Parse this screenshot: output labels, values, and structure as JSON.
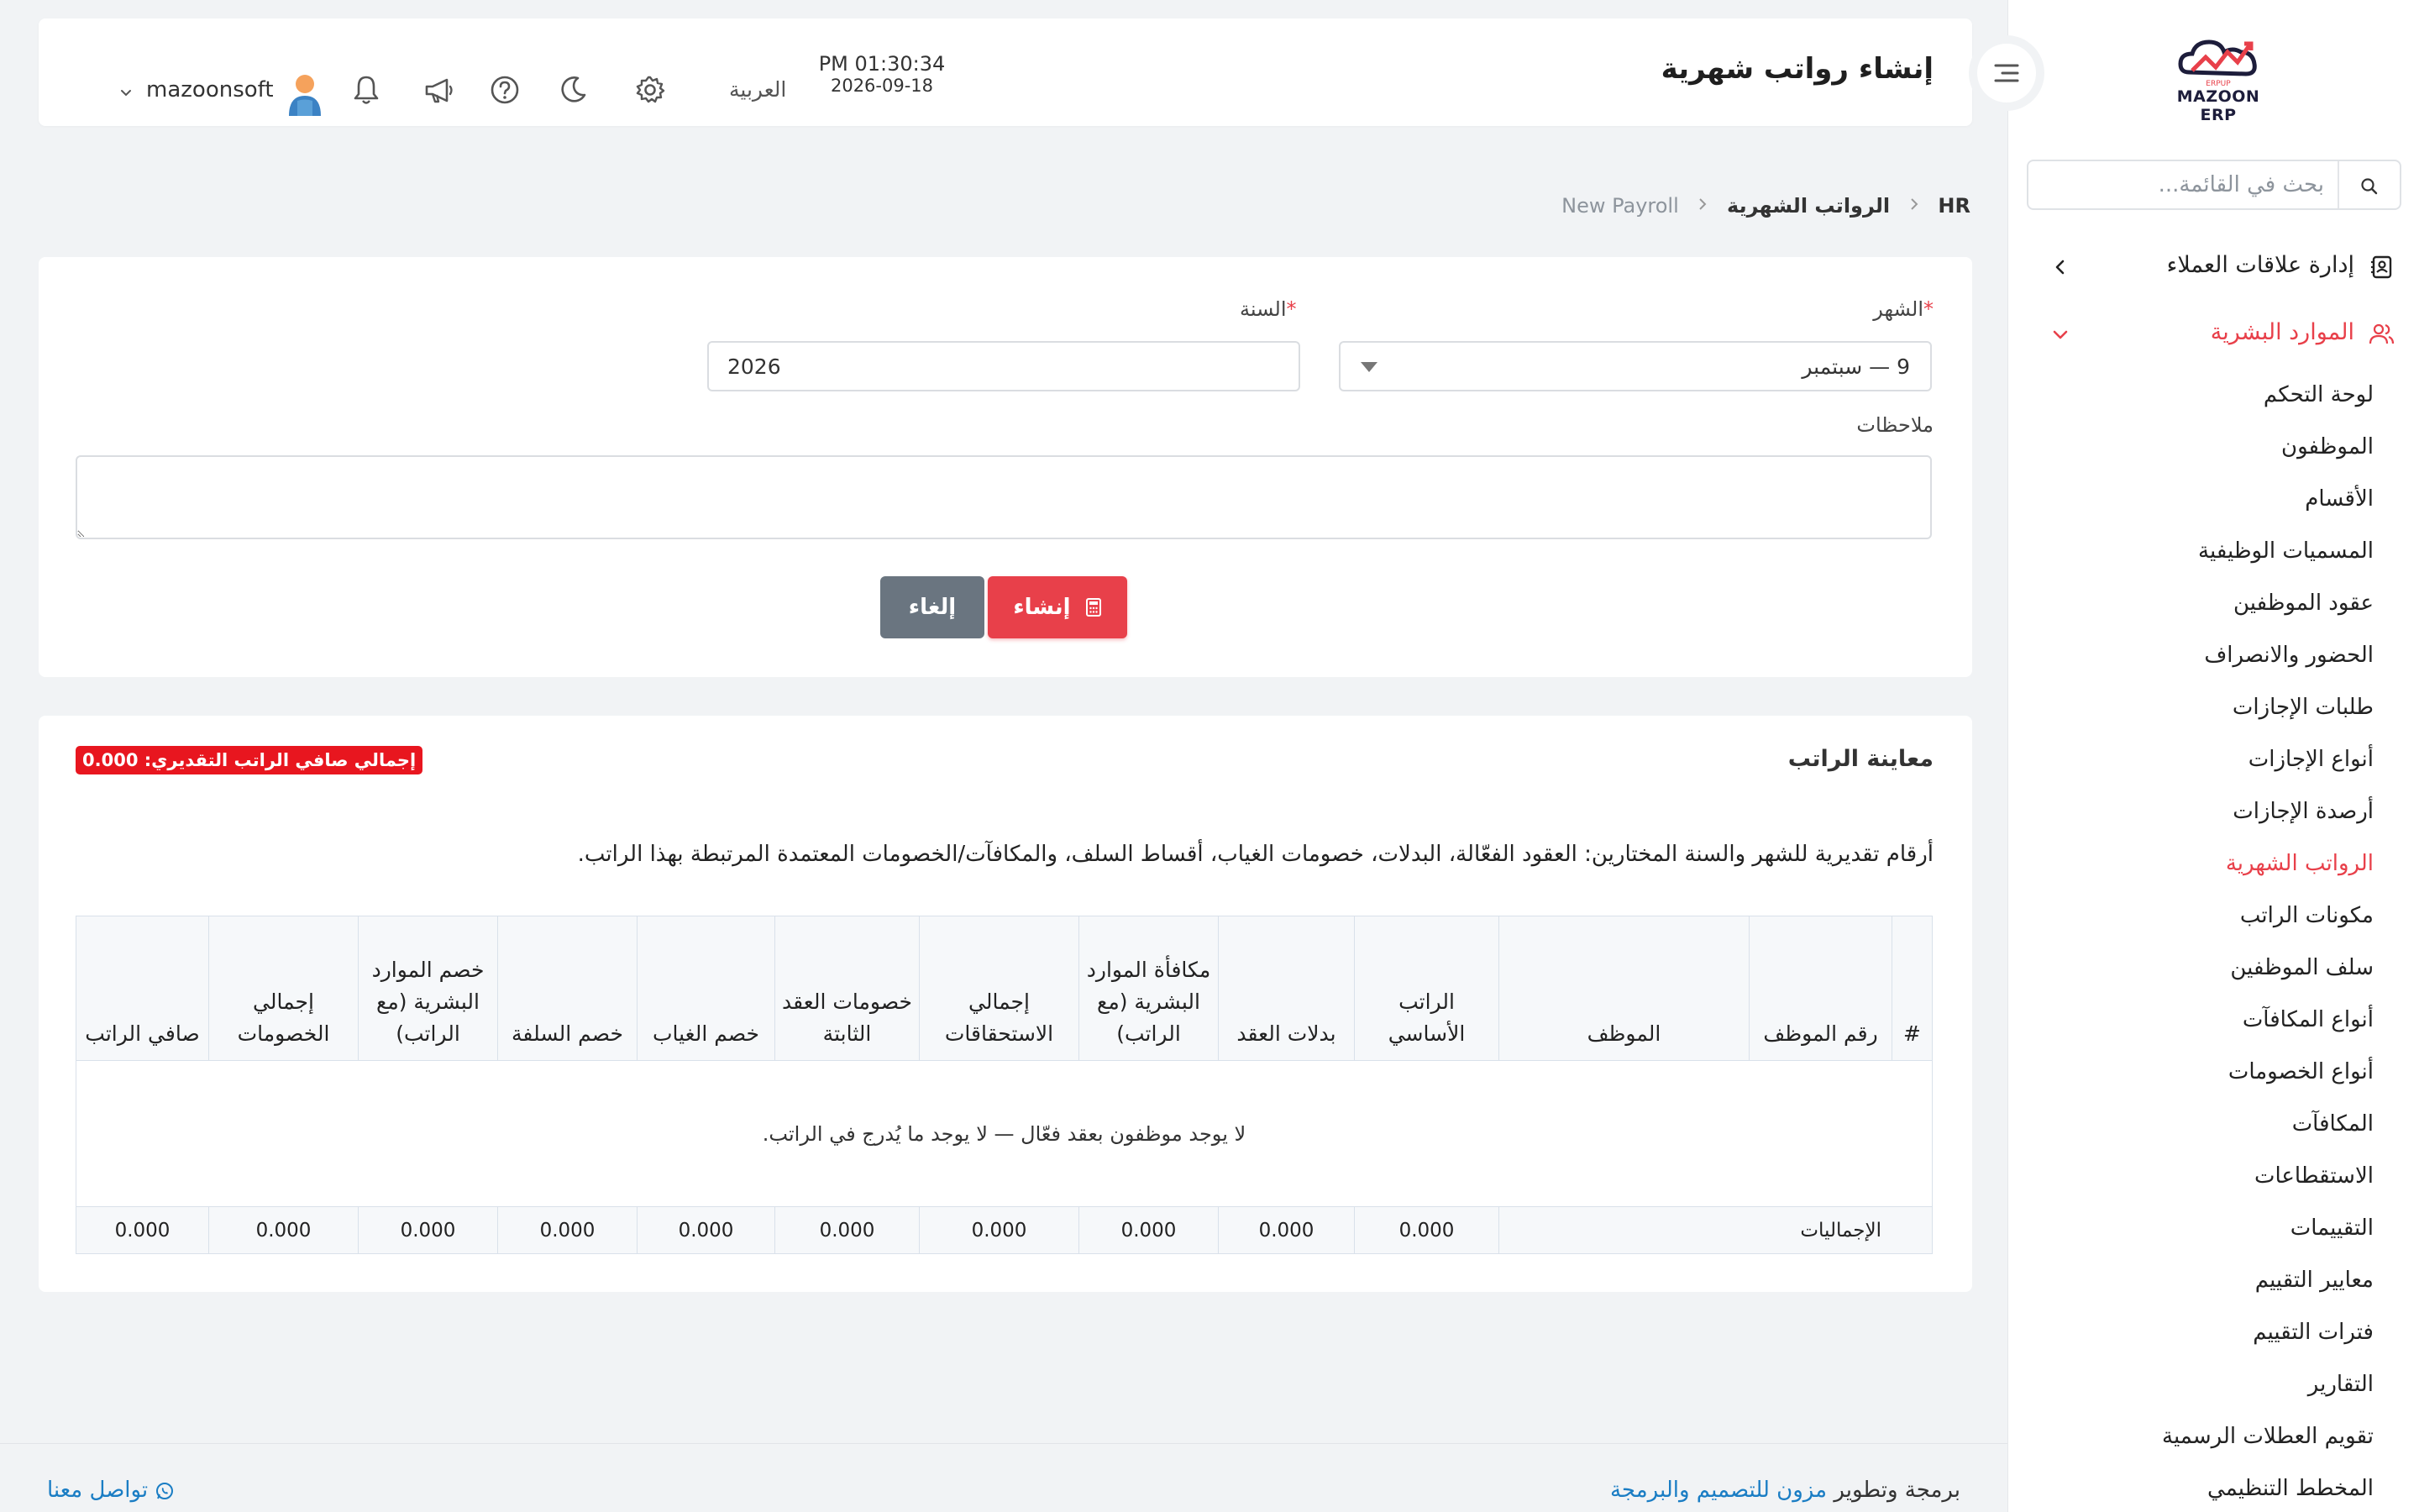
{
  "sidebar": {
    "logo_text": "MAZOON ERP",
    "logo_subtext": "ERPUP",
    "search_placeholder": "بحث في القائمة...",
    "crm_label": "إدارة علاقات العملاء",
    "hr_label": "الموارد البشرية",
    "items": [
      {
        "label": "لوحة التحكم"
      },
      {
        "label": "الموظفون"
      },
      {
        "label": "الأقسام"
      },
      {
        "label": "المسميات الوظيفية"
      },
      {
        "label": "عقود الموظفين"
      },
      {
        "label": "الحضور والانصراف"
      },
      {
        "label": "طلبات الإجازات"
      },
      {
        "label": "أنواع الإجازات"
      },
      {
        "label": "أرصدة الإجازات"
      },
      {
        "label": "الرواتب الشهرية",
        "active": true
      },
      {
        "label": "مكونات الراتب"
      },
      {
        "label": "سلف الموظفين"
      },
      {
        "label": "أنواع المكافآت"
      },
      {
        "label": "أنواع الخصومات"
      },
      {
        "label": "المكافآت"
      },
      {
        "label": "الاستقطاعات"
      },
      {
        "label": "التقييمات"
      },
      {
        "label": "معايير التقييم"
      },
      {
        "label": "فترات التقييم"
      },
      {
        "label": "التقارير"
      },
      {
        "label": "تقويم العطلات الرسمية"
      },
      {
        "label": "المخطط التنظيمي"
      }
    ]
  },
  "header": {
    "title": "إنشاء رواتب شهرية",
    "time": "PM 01:30:34",
    "date": "2026-09-18",
    "language": "العربية",
    "username": "mazoonsoft",
    "icons": [
      "settings-icon",
      "moon-icon",
      "help-icon",
      "megaphone-icon",
      "bell-icon"
    ]
  },
  "breadcrumb": {
    "root": "HR",
    "section": "الرواتب الشهرية",
    "current": "New Payroll"
  },
  "form": {
    "month_label": "الشهر",
    "month_value": "9 — سبتمبر",
    "year_label": "السنة",
    "year_value": "2026",
    "required_mark": "*",
    "notes_label": "ملاحظات",
    "notes_value": "",
    "create_label": "إنشاء",
    "cancel_label": "إلغاء"
  },
  "preview": {
    "title": "معاينة الراتب",
    "net_badge": "إجمالي صافي الراتب التقديري: 0.000",
    "description": "أرقام تقديرية للشهر والسنة المختارين: العقود الفعّالة، البدلات، خصومات الغياب، أقساط السلف، والمكافآت/الخصومات المعتمدة المرتبطة بهذا الراتب.",
    "columns": [
      "#",
      "رقم الموظف",
      "الموظف",
      "الراتب الأساسي",
      "بدلات العقد",
      "مكافأة الموارد البشرية (مع الراتب)",
      "إجمالي الاستحقاقات",
      "خصومات العقد الثابتة",
      "خصم الغياب",
      "خصم السلفة",
      "خصم الموارد البشرية (مع الراتب)",
      "إجمالي الخصومات",
      "صافي الراتب"
    ],
    "empty_message": "لا يوجد موظفون بعقد فعّال — لا يوجد ما يُدرج في الراتب.",
    "totals_label": "الإجماليات",
    "totals": [
      "0.000",
      "0.000",
      "0.000",
      "0.000",
      "0.000",
      "0.000",
      "0.000",
      "0.000",
      "0.000",
      "0.000"
    ]
  },
  "footer": {
    "credit_prefix": "برمجة وتطوير",
    "credit_company": "مزون للتصميم والبرمجة",
    "contact": "تواصل معنا"
  },
  "colors": {
    "accent": "#e8404a",
    "badge": "#e8161f",
    "cancel": "#6a7580",
    "link": "#1a7dc4"
  }
}
